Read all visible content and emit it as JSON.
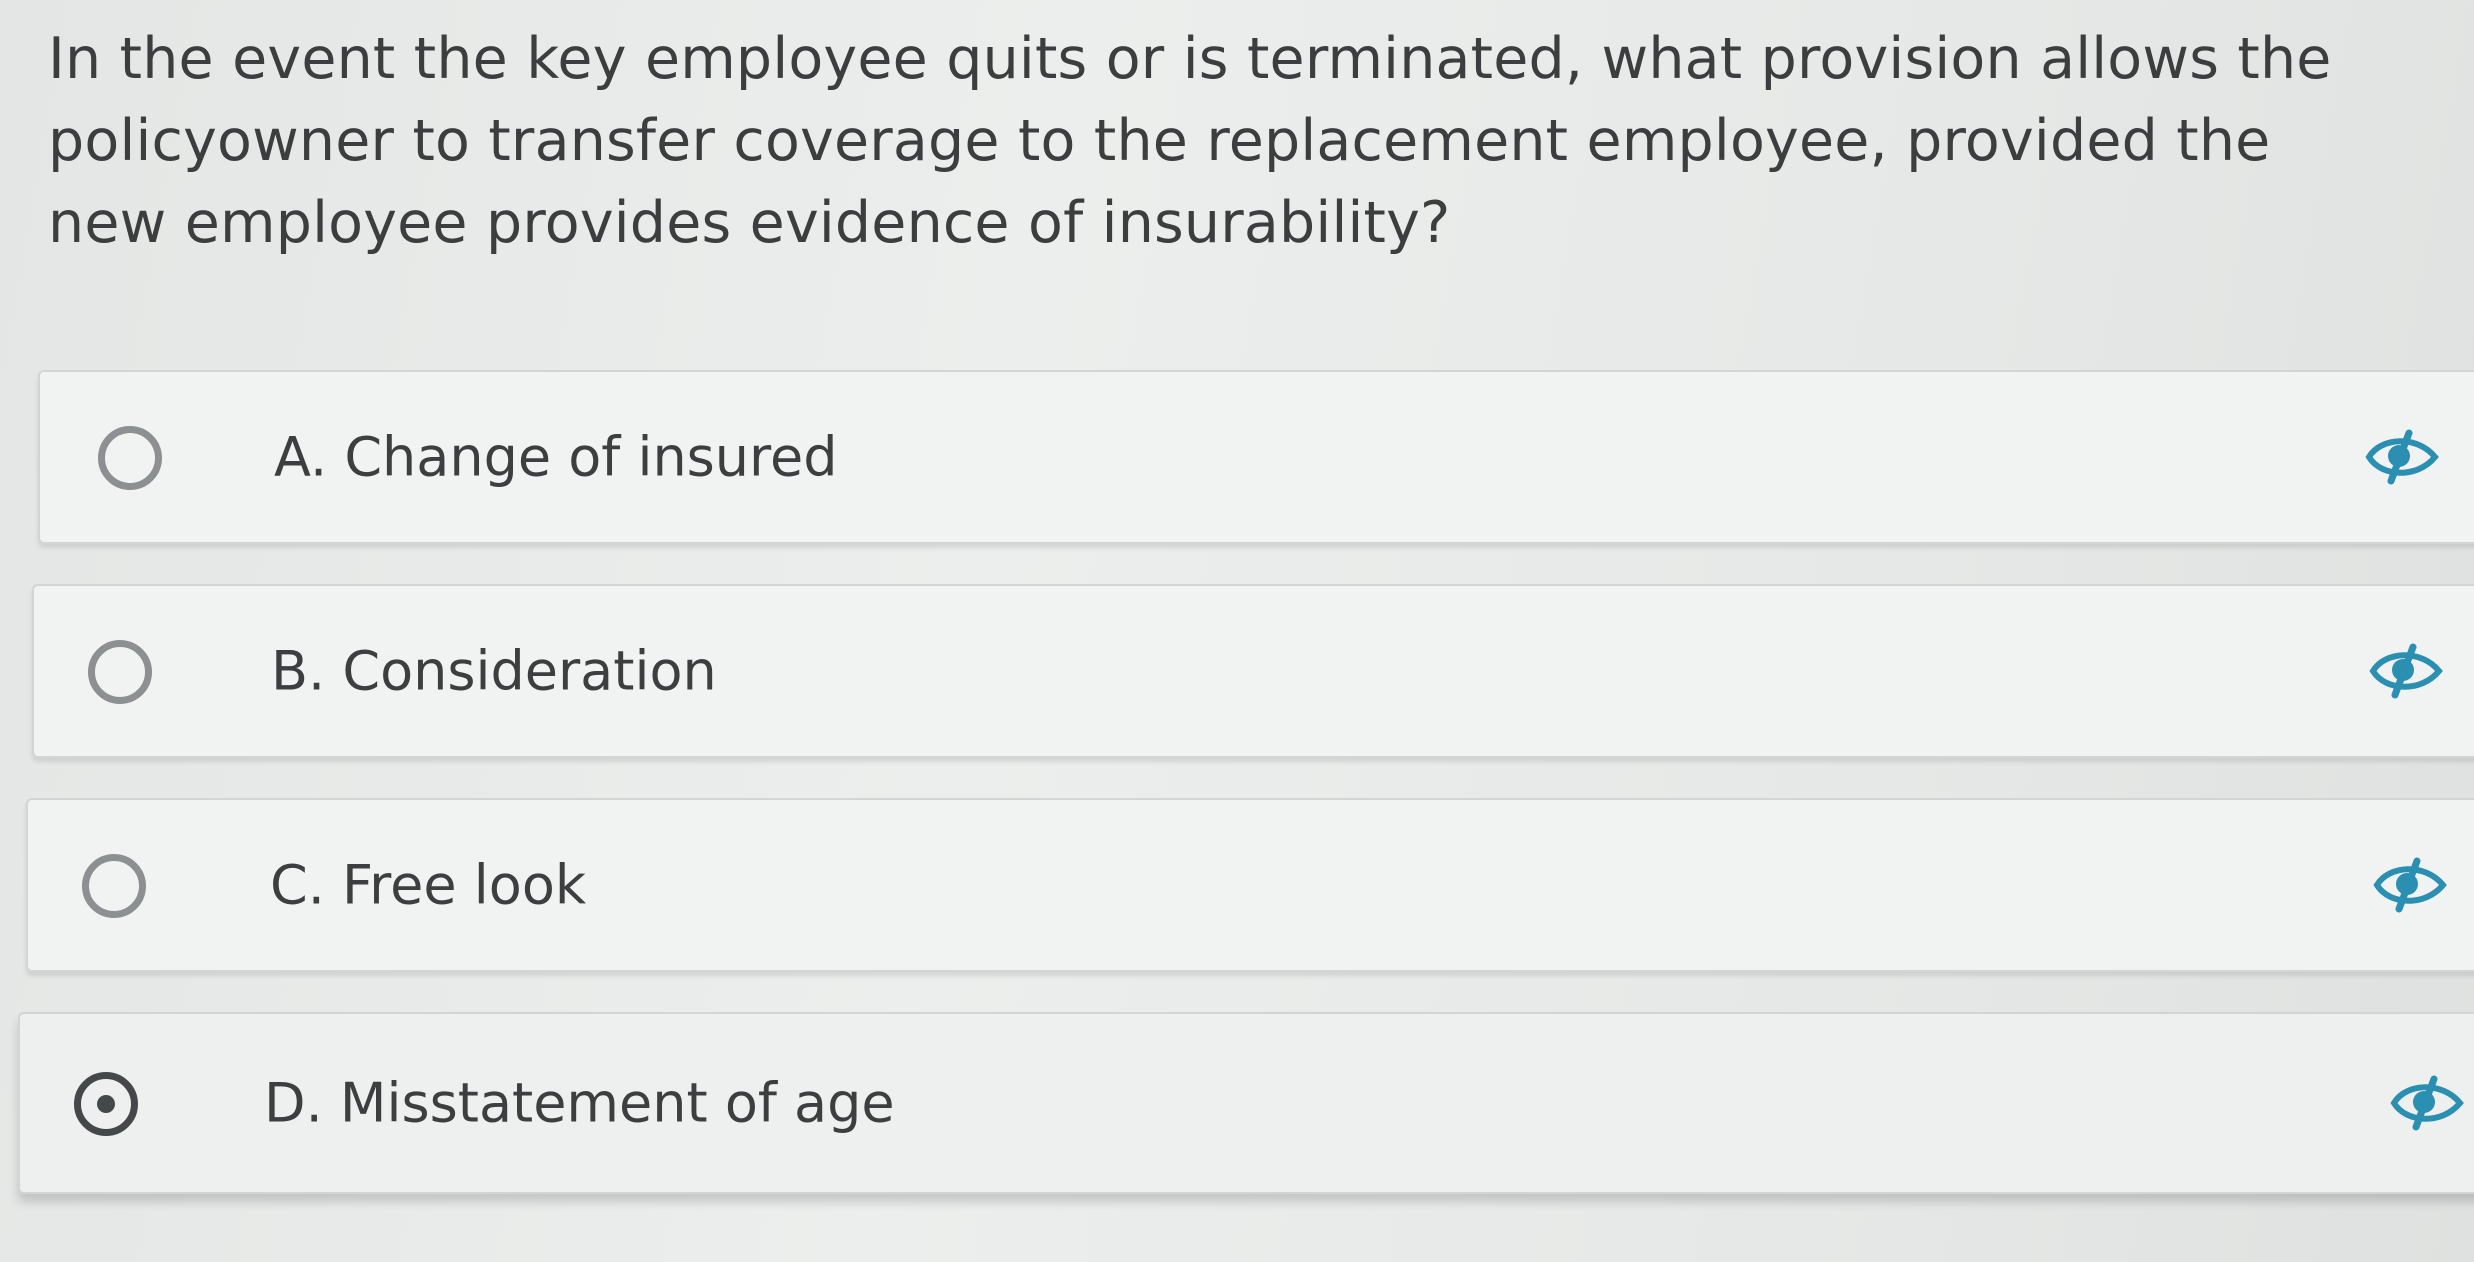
{
  "question": {
    "text": "In the event the key employee quits or is terminated, what provision allows the policyowner to transfer coverage to the replacement employee, provided the new employee provides evidence of insurability?"
  },
  "options": [
    {
      "label": "A. Change of insured",
      "selected": false
    },
    {
      "label": "B. Consideration",
      "selected": false
    },
    {
      "label": "C. Free look",
      "selected": false
    },
    {
      "label": "D. Misstatement of age",
      "selected": true
    }
  ],
  "icons": {
    "radio": "radio-button-icon",
    "hide_option": "eye-slash-icon"
  },
  "colors": {
    "text": "#3b3d3f",
    "radio_unselected": "#8d9092",
    "radio_selected": "#45484a",
    "eye_icon": "#2a8fb0"
  }
}
